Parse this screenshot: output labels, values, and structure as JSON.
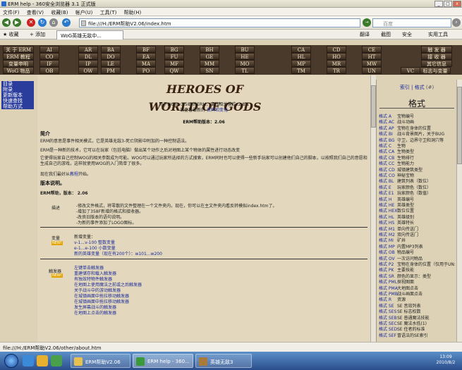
{
  "window": {
    "title": "ERM help - 360安全浏览器 3.1 正式版"
  },
  "menu": [
    "文件(F)",
    "查看(V)",
    "收藏(B)",
    "帐户(U)",
    "工具(T)",
    "帮助(H)"
  ],
  "address": {
    "value": "file:///H:/ERM帮助V2.06/index.htm"
  },
  "search": {
    "placeholder": "百度"
  },
  "favbar": {
    "favorites": "收藏",
    "add": "添加",
    "tab_title": "WoG英雄无敌中...",
    "translate": "翻译",
    "screenshot": "截图",
    "security": "安全",
    "tools": "实用工具"
  },
  "topmenu": {
    "rows": [
      [
        "关 于 ERM",
        "AI",
        "AR",
        "BA",
        "BF",
        "BG",
        "BH",
        "BU",
        "CA",
        "CD",
        "CE",
        "触 发 器"
      ],
      [
        "ERM 教程",
        "CO",
        "DL",
        "DO",
        "EA",
        "FU",
        "GE",
        "HE",
        "HL",
        "HO",
        "HT",
        "接 收 器"
      ],
      [
        "变量申明",
        "IF",
        "IP",
        "LE",
        "MA",
        "MF",
        "MM",
        "MO",
        "MP",
        "MR",
        "MW",
        "其它信息"
      ],
      [
        "WoG 物品",
        "OB",
        "OW",
        "PM",
        "PO",
        "QW",
        "SN",
        "TL",
        "TM",
        "TR",
        "UN",
        "VC",
        "标志与变量"
      ]
    ]
  },
  "leftnav": [
    "目录",
    "附录",
    "更新版本",
    "快速查找",
    "帮助方式"
  ],
  "main": {
    "logo": "HEROES OF WORLD OF GODS",
    "sub1": "用于WoG v3.58F的ERM，事件相关模式v2.8.1",
    "sub2_pre": "请查看最新的",
    "sub2_link": "资料和变化",
    "version_line": "ERM帮助版本：2.06",
    "intro_head": "简介",
    "intro1": "ERM的意思是事件相关模式，它是英雄无敌3-死亡阴影中附加的一种控制语法。",
    "intro2": "ERM是一种新的技术，它可以在玩家（包括电脑）做出某个动作之后对地图上某个物体的属性进行动态改变",
    "intro3": "它使得玩家自己控制WOG的相关参数成为可能。WOG可以通过玩家所选择的方式搜索，ERM同时也可以使得一些新手玩家可以创建他们自己的脚本，以按照我们自己的意愿和生成自己的游戏，这样就使用WOG的入门简单了很多。",
    "intro4_pre": "现在我们最好从",
    "intro4_link": "教程",
    "intro4_post": "开始。",
    "ver_head": "版本说明。",
    "ver_label": "ERM帮助，版本：",
    "ver_value": "2.06",
    "desc_label": "描述",
    "desc_lines": [
      "-修改文件格式，将零散的文件整理在一个文件夹内，现在，你可以在主文件夹内看反转模拟index.htm了。",
      "-增加了358F新增的格式和接收器。",
      "-改良旧版本的语句说明。",
      "-为新的事件添加了LOGO图标。"
    ],
    "vars_label": "变量",
    "vars_new": "新增变量：",
    "vars_links": [
      "v-1...v-100 整数变量",
      "e-1...e-100 小数变量",
      "新的英雄变量（现在有200个）：w101...w200"
    ],
    "trig_label": "触发器",
    "trig_links": [
      "左键单击触发器",
      "重建储存和载入触发器",
      "有独效特物件触发器",
      "在地图上使用魔法之前或之后触发器",
      "关于战斗中的游动触发器",
      "在城镇画面中拖拉移动触发器",
      "在城镇画面中拖拉移动触发器",
      "发生屏幕战斗的触发器",
      "在地图上点击的触发器"
    ],
    "new_badge": "NEW!"
  },
  "rightpane": {
    "header": "索引 | 格式",
    "hash": "(#)",
    "title": "格式",
    "items": [
      [
        "格式 A",
        "宝物编号"
      ],
      [
        "格式 AC",
        "战斗动画"
      ],
      [
        "格式 AP",
        "宝物在身体的位置"
      ],
      [
        "格式 BI",
        "战斗背景图片，关于BUG"
      ],
      [
        "格式 BG",
        "守卫，边界守卫和洞穴等"
      ],
      [
        "格式 C",
        "生物"
      ],
      [
        "格式 CA",
        "生物类型"
      ],
      [
        "格式 CB",
        "生物排行"
      ],
      [
        "格式 CC",
        "生物能力"
      ],
      [
        "格式 CD",
        "城镇建筑类型"
      ],
      [
        "格式 CO",
        "神秘宝物"
      ],
      [
        "格式 BL",
        "建筑列表（数位）"
      ],
      [
        "格式 E",
        "玩家颜色（数位）"
      ],
      [
        "格式 E1",
        "玩家颜色（数值）"
      ],
      [
        "格式 H",
        "英雄编号"
      ],
      [
        "格式 HE",
        "英雄类型"
      ],
      [
        "格式 HEX",
        "数位位置"
      ],
      [
        "格式 HL",
        "英雄级别"
      ],
      [
        "格式 HS",
        "英雄特长"
      ],
      [
        "格式 M1",
        "单向传送门"
      ],
      [
        "格式 M2",
        "双向传送门"
      ],
      [
        "格式 MI",
        "矿井"
      ],
      [
        "格式 MP",
        "内置MP3列表"
      ],
      [
        "格式 OB",
        "物品编号"
      ],
      [
        "格式 OV",
        "一次访问物品"
      ],
      [
        "格式 P2",
        "宝物在身体的位置（仅用于UN:A）"
      ],
      [
        "格式 PK",
        "主要技能"
      ],
      [
        "格式 SR",
        "颜色的显示：类型"
      ],
      [
        "格式 PML",
        "探视图面"
      ],
      [
        "格式 PMA",
        "大地图点击"
      ],
      [
        "格式 PMB",
        "战斗画面点击"
      ],
      [
        "格式 R",
        "资源"
      ],
      [
        "格式 SE",
        "SE 音效列表"
      ],
      [
        "格式 SES",
        "SE 标志权数"
      ],
      [
        "格式 SEB",
        "SE 普通魔法技能"
      ],
      [
        "格式 SEC",
        "SE 魔法水低(1)"
      ],
      [
        "格式 SED",
        "SE 任者的标准"
      ],
      [
        "格式 SEF",
        "冒语法的SE索引"
      ]
    ]
  },
  "status": {
    "text": "file:///H:/ERM帮助V2.06/other/about.htm"
  },
  "taskbar": {
    "tasks": [
      "ERM帮助V2.06",
      "ERM help - 360...",
      "英雄无敌3"
    ],
    "time": "13:09",
    "date": "2010/8/2"
  }
}
